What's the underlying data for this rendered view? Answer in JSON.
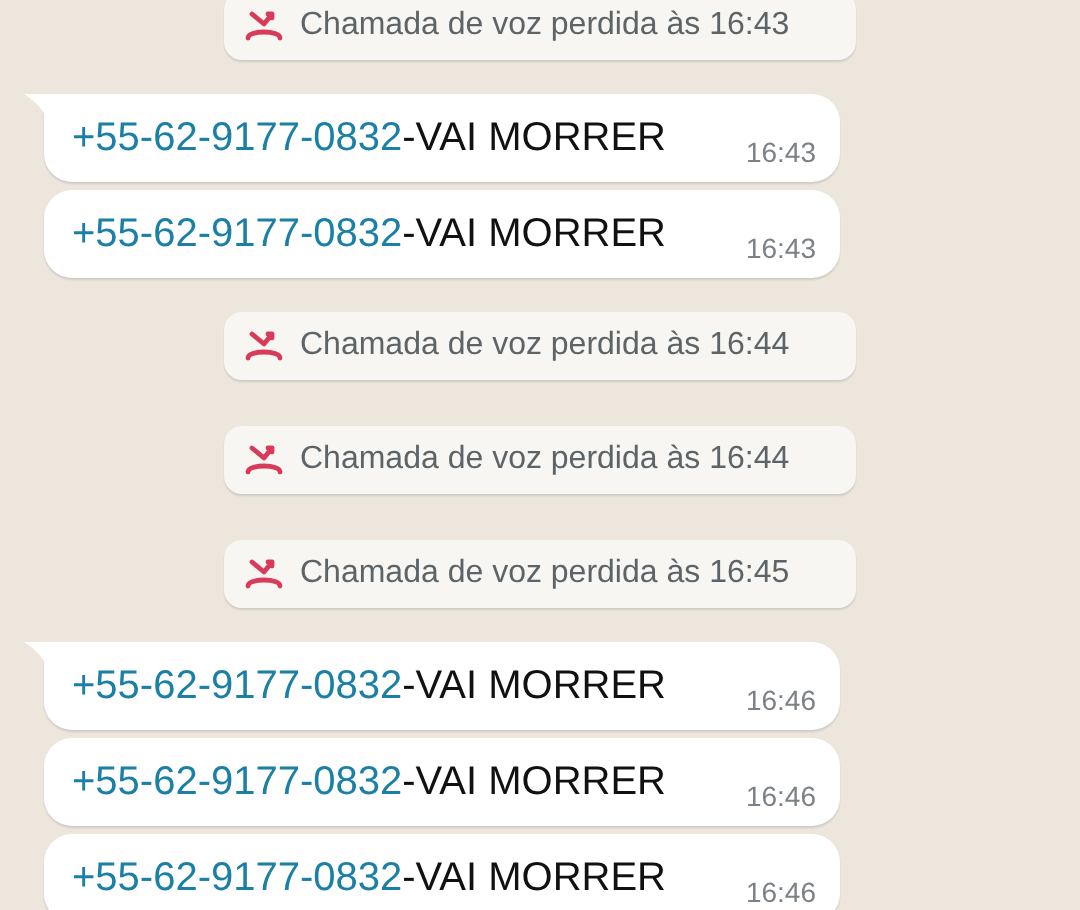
{
  "messages": [
    {
      "kind": "missed_call",
      "text": "Chamada de voz perdida às 16:43"
    },
    {
      "kind": "text",
      "link": "+55-62-9177-0832",
      "text": "-VAI MORRER",
      "time": "16:43"
    },
    {
      "kind": "text",
      "link": "+55-62-9177-0832",
      "text": "-VAI MORRER",
      "time": "16:43"
    },
    {
      "kind": "missed_call",
      "text": "Chamada de voz perdida às 16:44"
    },
    {
      "kind": "missed_call",
      "text": "Chamada de voz perdida às 16:44"
    },
    {
      "kind": "missed_call",
      "text": "Chamada de voz perdida às 16:45"
    },
    {
      "kind": "text",
      "link": "+55-62-9177-0832",
      "text": "-VAI MORRER",
      "time": "16:46"
    },
    {
      "kind": "text",
      "link": "+55-62-9177-0832",
      "text": "-VAI MORRER",
      "time": "16:46"
    },
    {
      "kind": "text",
      "link": "+55-62-9177-0832",
      "text": "-VAI MORRER",
      "time": "16:46"
    }
  ]
}
